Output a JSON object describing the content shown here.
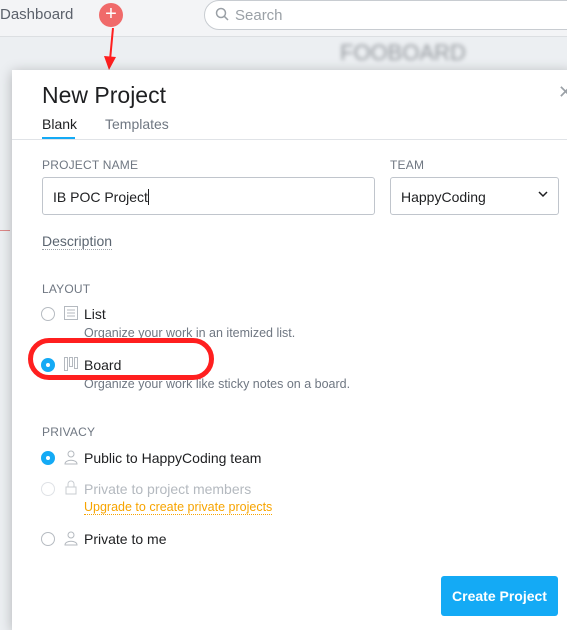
{
  "background": {
    "dashboard_label": "Dashboard",
    "search_placeholder": "Search",
    "blurred_text": "FOOBOARD"
  },
  "modal": {
    "title": "New Project",
    "tabs": [
      {
        "label": "Blank",
        "active": true
      },
      {
        "label": "Templates",
        "active": false
      }
    ],
    "project_name": {
      "label": "PROJECT NAME",
      "value": "IB POC Project"
    },
    "team": {
      "label": "TEAM",
      "value": "HappyCoding"
    },
    "description_link": "Description",
    "layout": {
      "label": "LAYOUT",
      "options": [
        {
          "label": "List",
          "sub": "Organize your work in an itemized list.",
          "selected": false,
          "icon": "list-icon"
        },
        {
          "label": "Board",
          "sub": "Organize your work like sticky notes on a board.",
          "selected": true,
          "icon": "board-icon"
        }
      ]
    },
    "privacy": {
      "label": "PRIVACY",
      "options": [
        {
          "label": "Public to HappyCoding team",
          "selected": true,
          "disabled": false,
          "icon": "people-icon"
        },
        {
          "label": "Private to project members",
          "selected": false,
          "disabled": true,
          "icon": "lock-icon",
          "link": "Upgrade to create private projects"
        },
        {
          "label": "Private to me",
          "selected": false,
          "disabled": false,
          "icon": "person-icon"
        }
      ]
    },
    "create_button": "Create Project"
  },
  "colors": {
    "accent": "#14aaf5",
    "annotation_red": "#ff1f1f",
    "upgrade_link": "#f7a400",
    "plus_button": "#f06a6a"
  }
}
